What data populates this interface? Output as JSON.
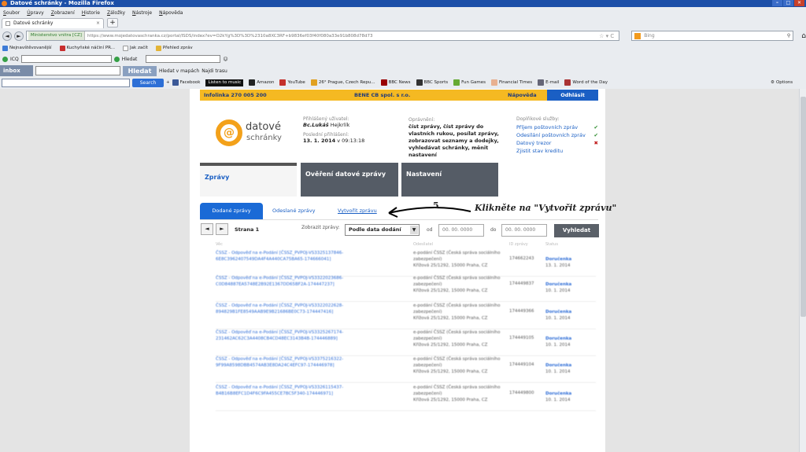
{
  "window": {
    "title": "Datové schránky - Mozilla Firefox"
  },
  "menu": [
    "Soubor",
    "Úpravy",
    "Zobrazení",
    "Historie",
    "Záložky",
    "Nástroje",
    "Nápověda"
  ],
  "tab": {
    "label": "Datové schránky"
  },
  "address": {
    "identity": "Ministerstvo vnitra [CZ]",
    "url": "https://www.mojedatovaschranka.cz/portal/ISDS/index?ev=O2kYg%3D%3D%2310a8XC3RF+b9836ef03f40f080a33e91b808d78d73"
  },
  "search": {
    "placeholder": "Bing"
  },
  "bookmarks": [
    "Nejnavštěvovanější",
    "Kuchyňské náčiní PR...",
    "Jak začít",
    "Přehled zpráv"
  ],
  "icq": {
    "label": "ICQ",
    "hledat": "Hledat"
  },
  "inbox": {
    "label": "inbox",
    "button": "Hledat",
    "maps": "Hledat v mapách",
    "route": "Najdi trasu"
  },
  "toolbar2": {
    "search": "Search",
    "items": [
      "Facebook",
      "Listen to music",
      "Amazon",
      "YouTube",
      "26° Prague, Czech Repu...",
      "BBC News",
      "BBC Sports",
      "Fun Games",
      "Financial Times",
      "E-mail",
      "Word of the Day"
    ],
    "options": "Options"
  },
  "portal": {
    "infolinka": "Infolinka 270 005 200",
    "company": "BENE CB spol. s r.o.",
    "napoveda": "Nápověda",
    "odhlasit": "Odhlásit",
    "logo": {
      "line1": "datové",
      "line2": "schránky",
      "symbol": "@"
    },
    "user": {
      "label": "Přihlášený uživatel:",
      "title": "Bc.Lukáš",
      "name": "Hejkrlík",
      "last_label": "Poslední přihlášení:",
      "last_date": "13. 1. 2014",
      "last_time": "v 09:13:18"
    },
    "opravneni": {
      "label": "Oprávnění:",
      "text": "číst zprávy, číst zprávy do vlastních rukou, posílat zprávy, zobrazovat seznamy a dodejky, vyhledávat schránky, měnit nastavení"
    },
    "services": {
      "label": "Doplňkové služby:",
      "items": [
        "Příjem poštovních zpráv",
        "Odesílání poštovních zpráv",
        "Datový trezor",
        "Zjistit stav kreditu"
      ]
    },
    "bigtabs": [
      "Zprávy",
      "Ověření datové zprávy",
      "Nastavení"
    ],
    "subtabs": [
      "Dodané zprávy",
      "Odeslané zprávy",
      "Vytvořit zprávu"
    ],
    "annotation": {
      "number": "5",
      "text": "Klikněte na \"Vytvořit zprávu\""
    },
    "pager": {
      "prev": "◄",
      "next": "►",
      "label": "Strana 1"
    },
    "filter": {
      "label": "Zobrazit zprávy:",
      "value": "Podle data dodání",
      "od": "od",
      "do": "do",
      "date_placeholder": "00. 00. 0000",
      "button": "Vyhledat"
    },
    "columns": [
      "Věc",
      "Odesílatel",
      "ID zprávy",
      "Status"
    ],
    "messages": [
      {
        "subject": "ČSSZ - Odpověď na e-Podání [ČSSZ_PVPOJ-VS3325137846-6E8C3962407549DA4F4A440CA75BA65-174666041]",
        "sender": "e-podání ČSSZ (Česká správa sociálního zabezpečení)",
        "address": "Křížová 25/1292, 15000 Praha, CZ",
        "id": "174662243",
        "status": "Doručenka",
        "date": "13. 1. 2014"
      },
      {
        "subject": "ČSSZ - Odpověď na e-Podání [ČSSZ_PVPOJ-VS3322023686-C0D84887EA5748E2B92E1367DD65BF2A-174447237]",
        "sender": "e-podání ČSSZ (Česká správa sociálního zabezpečení)",
        "address": "Křížová 25/1292, 15000 Praha, CZ",
        "id": "174449837",
        "status": "Doručenka",
        "date": "10. 1. 2014"
      },
      {
        "subject": "ČSSZ - Odpověď na e-Podání [ČSSZ_PVPOJ-VS3322022628-894829B1FE8549AAB9E9B21686BE0C73-174447416]",
        "sender": "e-podání ČSSZ (Česká správa sociálního zabezpečení)",
        "address": "Křížová 25/1292, 15000 Praha, CZ",
        "id": "174449366",
        "status": "Doručenka",
        "date": "10. 1. 2014"
      },
      {
        "subject": "ČSSZ - Odpověď na e-Podání [ČSSZ_PVPOJ-VS3325267174-231462AC62C3A4408CB4CD48EC3143B4B-174446889]",
        "sender": "e-podání ČSSZ (Česká správa sociálního zabezpečení)",
        "address": "Křížová 25/1292, 15000 Praha, CZ",
        "id": "174449105",
        "status": "Doručenka",
        "date": "10. 1. 2014"
      },
      {
        "subject": "ČSSZ - Odpověď na e-Podání [ČSSZ_PVPOJ-VS3375216322-9F99A8598DBB4574AB3E8DA24C4EFC97-174446978]",
        "sender": "e-podání ČSSZ (Česká správa sociálního zabezpečení)",
        "address": "Křížová 25/1292, 15000 Praha, CZ",
        "id": "174449104",
        "status": "Doručenka",
        "date": "10. 1. 2014"
      },
      {
        "subject": "ČSSZ - Odpověď na e-Podání [ČSSZ_PVPOJ-VS3326115437-B4B16B8EFC1D4F6C9FA455CE7BC5F340-174446971]",
        "sender": "e-podání ČSSZ (Česká správa sociálního zabezpečení)",
        "address": "Křížová 25/1292, 15000 Praha, CZ",
        "id": "174449800",
        "status": "Doručenka",
        "date": "10. 1. 2014"
      }
    ]
  }
}
